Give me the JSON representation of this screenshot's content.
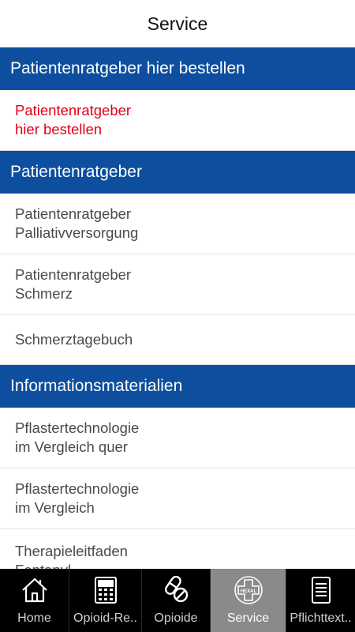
{
  "header": {
    "title": "Service"
  },
  "sections": [
    {
      "title": "Patientenratgeber hier bestellen",
      "items": [
        {
          "line1": "Patientenratgeber",
          "line2": "hier bestellen"
        }
      ]
    },
    {
      "title": "Patientenratgeber",
      "items": [
        {
          "line1": "Patientenratgeber",
          "line2": "Palliativversorgung"
        },
        {
          "line1": "Patientenratgeber",
          "line2": "Schmerz"
        },
        {
          "line1": "Schmerztagebuch"
        }
      ]
    },
    {
      "title": "Informationsmaterialien",
      "items": [
        {
          "line1": "Pflastertechnologie",
          "line2": "im Vergleich quer"
        },
        {
          "line1": "Pflastertechnologie",
          "line2": "im Vergleich"
        },
        {
          "line1": "Therapieleitfaden",
          "line2": "Fentanyl"
        }
      ]
    }
  ],
  "tabs": [
    {
      "label": "Home",
      "icon": "home-icon"
    },
    {
      "label": "Opioid-Re..",
      "icon": "calculator-icon"
    },
    {
      "label": "Opioide",
      "icon": "pills-icon"
    },
    {
      "label": "Service",
      "icon": "hexal-logo-icon",
      "active": true
    },
    {
      "label": "Pflichttext..",
      "icon": "document-icon"
    }
  ],
  "colors": {
    "header_blue": "#0d4f9e",
    "link_red": "#e2001a",
    "active_tab": "#8a8a8a"
  }
}
